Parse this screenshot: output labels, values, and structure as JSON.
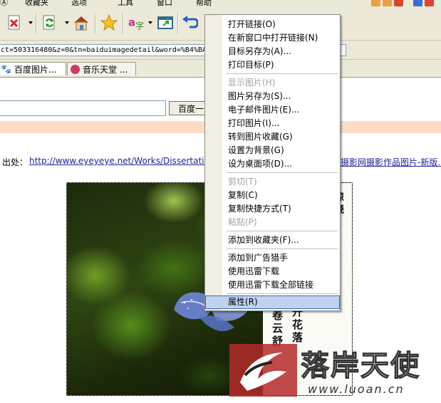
{
  "menubar": {
    "items": [
      "收藏夹",
      "选项",
      "工具",
      "窗口",
      "帮助"
    ]
  },
  "toolbar": {
    "buttons": [
      "stop-icon",
      "refresh-icon",
      "home-icon",
      "favorites-star-icon",
      "translate-icon",
      "window-icon",
      "undo-icon"
    ]
  },
  "address": {
    "value": "ct=503316480&z=0&tn=baiduimagedetail&word=%B4%BA"
  },
  "tabs": [
    {
      "label": "百度图片..."
    },
    {
      "label": "音乐天堂 ..."
    }
  ],
  "page": {
    "search_button": "百度一",
    "source_label": "出处：",
    "source_link": "http://www.eyeyeye.net/Works/Dissertation_In",
    "source_link_tail": "摄影网摄影作品图片-新版..."
  },
  "poem": {
    "col1": "花开花落",
    "col2": "卷云舒",
    "right_fragment": "惊晓"
  },
  "watermark": {
    "text": "落岸天使",
    "url": "www.luoan.cn"
  },
  "context_menu": {
    "items": [
      {
        "label": "打开链接(O)",
        "disabled": false
      },
      {
        "label": "在新窗口中打开链接(N)",
        "disabled": false
      },
      {
        "label": "目标另存为(A)...",
        "disabled": false
      },
      {
        "label": "打印目标(P)",
        "disabled": false
      },
      {
        "label": "显示图片(H)",
        "disabled": true
      },
      {
        "label": "图片另存为(S)...",
        "disabled": false
      },
      {
        "label": "电子邮件图片(E)...",
        "disabled": false
      },
      {
        "label": "打印图片(I)...",
        "disabled": false
      },
      {
        "label": "转到图片收藏(G)",
        "disabled": false
      },
      {
        "label": "设置为背景(G)",
        "disabled": false
      },
      {
        "label": "设为桌面项(D)...",
        "disabled": false
      },
      {
        "label": "剪切(T)",
        "disabled": true
      },
      {
        "label": "复制(C)",
        "disabled": false
      },
      {
        "label": "复制快捷方式(T)",
        "disabled": false
      },
      {
        "label": "粘贴(P)",
        "disabled": true
      },
      {
        "label": "添加到收藏夹(F)...",
        "disabled": false
      },
      {
        "label": "添加到广告猎手",
        "disabled": false
      },
      {
        "label": "使用迅雷下载",
        "disabled": false
      },
      {
        "label": "使用迅雷下载全部链接",
        "disabled": false
      },
      {
        "label": "属性(R)",
        "disabled": false,
        "highlighted": true
      }
    ]
  },
  "colors": {
    "chrome": "#ece9d8",
    "menu_highlight": "#c1d2ee",
    "link": "#22229c",
    "band": "#fddcc3"
  }
}
